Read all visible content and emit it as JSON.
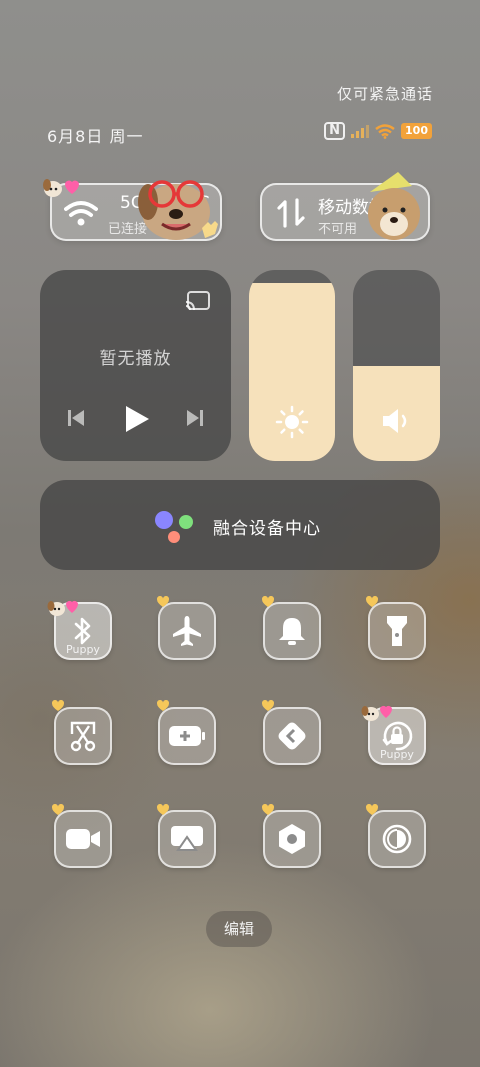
{
  "status": {
    "emergency_only": "仅可紧急通话",
    "date": "6月8日 周一",
    "nfc": "N",
    "battery": "100"
  },
  "wifi_tile": {
    "title": "5G",
    "title_suffix": "MIC",
    "subtitle": "已连接",
    "icon": "wifi-icon"
  },
  "data_tile": {
    "title": "移动数据",
    "subtitle": "不可用",
    "icon": "data-arrows-icon"
  },
  "media": {
    "title": "暂无播放",
    "icons": [
      "cast-icon",
      "previous-icon",
      "play-icon",
      "next-icon"
    ]
  },
  "brightness": {
    "level": 0.93,
    "icon": "sun-icon"
  },
  "volume": {
    "level": 0.5,
    "icon": "speaker-icon"
  },
  "device_center": {
    "label": "融合设备中心",
    "dot_colors": [
      "#8a86ff",
      "#7fe07d",
      "#ff8e7a"
    ]
  },
  "toggles": [
    {
      "id": "bluetooth",
      "icon": "bluetooth-icon",
      "label": "Puppy",
      "active": true
    },
    {
      "id": "airplane",
      "icon": "airplane-icon",
      "label": "",
      "active": false
    },
    {
      "id": "bell",
      "icon": "bell-icon",
      "label": "",
      "active": false
    },
    {
      "id": "flashlight",
      "icon": "flashlight-icon",
      "label": "",
      "active": false
    },
    {
      "id": "screenshot",
      "icon": "scissors-icon",
      "label": "",
      "active": false
    },
    {
      "id": "battery-saver",
      "icon": "battery-plus-icon",
      "label": "",
      "active": false
    },
    {
      "id": "share",
      "icon": "share-icon",
      "label": "",
      "active": false
    },
    {
      "id": "rotation-lock",
      "icon": "rotation-lock-icon",
      "label": "Puppy",
      "active": true
    },
    {
      "id": "screen-record",
      "icon": "video-camera-icon",
      "label": "",
      "active": false
    },
    {
      "id": "screen-cast",
      "icon": "screen-cast-icon",
      "label": "",
      "active": false
    },
    {
      "id": "settings",
      "icon": "hexagon-nut-icon",
      "label": "",
      "active": false
    },
    {
      "id": "dark-mode",
      "icon": "contrast-icon",
      "label": "",
      "active": false
    }
  ],
  "edit_button": "编辑",
  "colors": {
    "slider_fill": "#f6e1bb",
    "battery": "#f2a23a",
    "heart": "#f5c75a"
  }
}
